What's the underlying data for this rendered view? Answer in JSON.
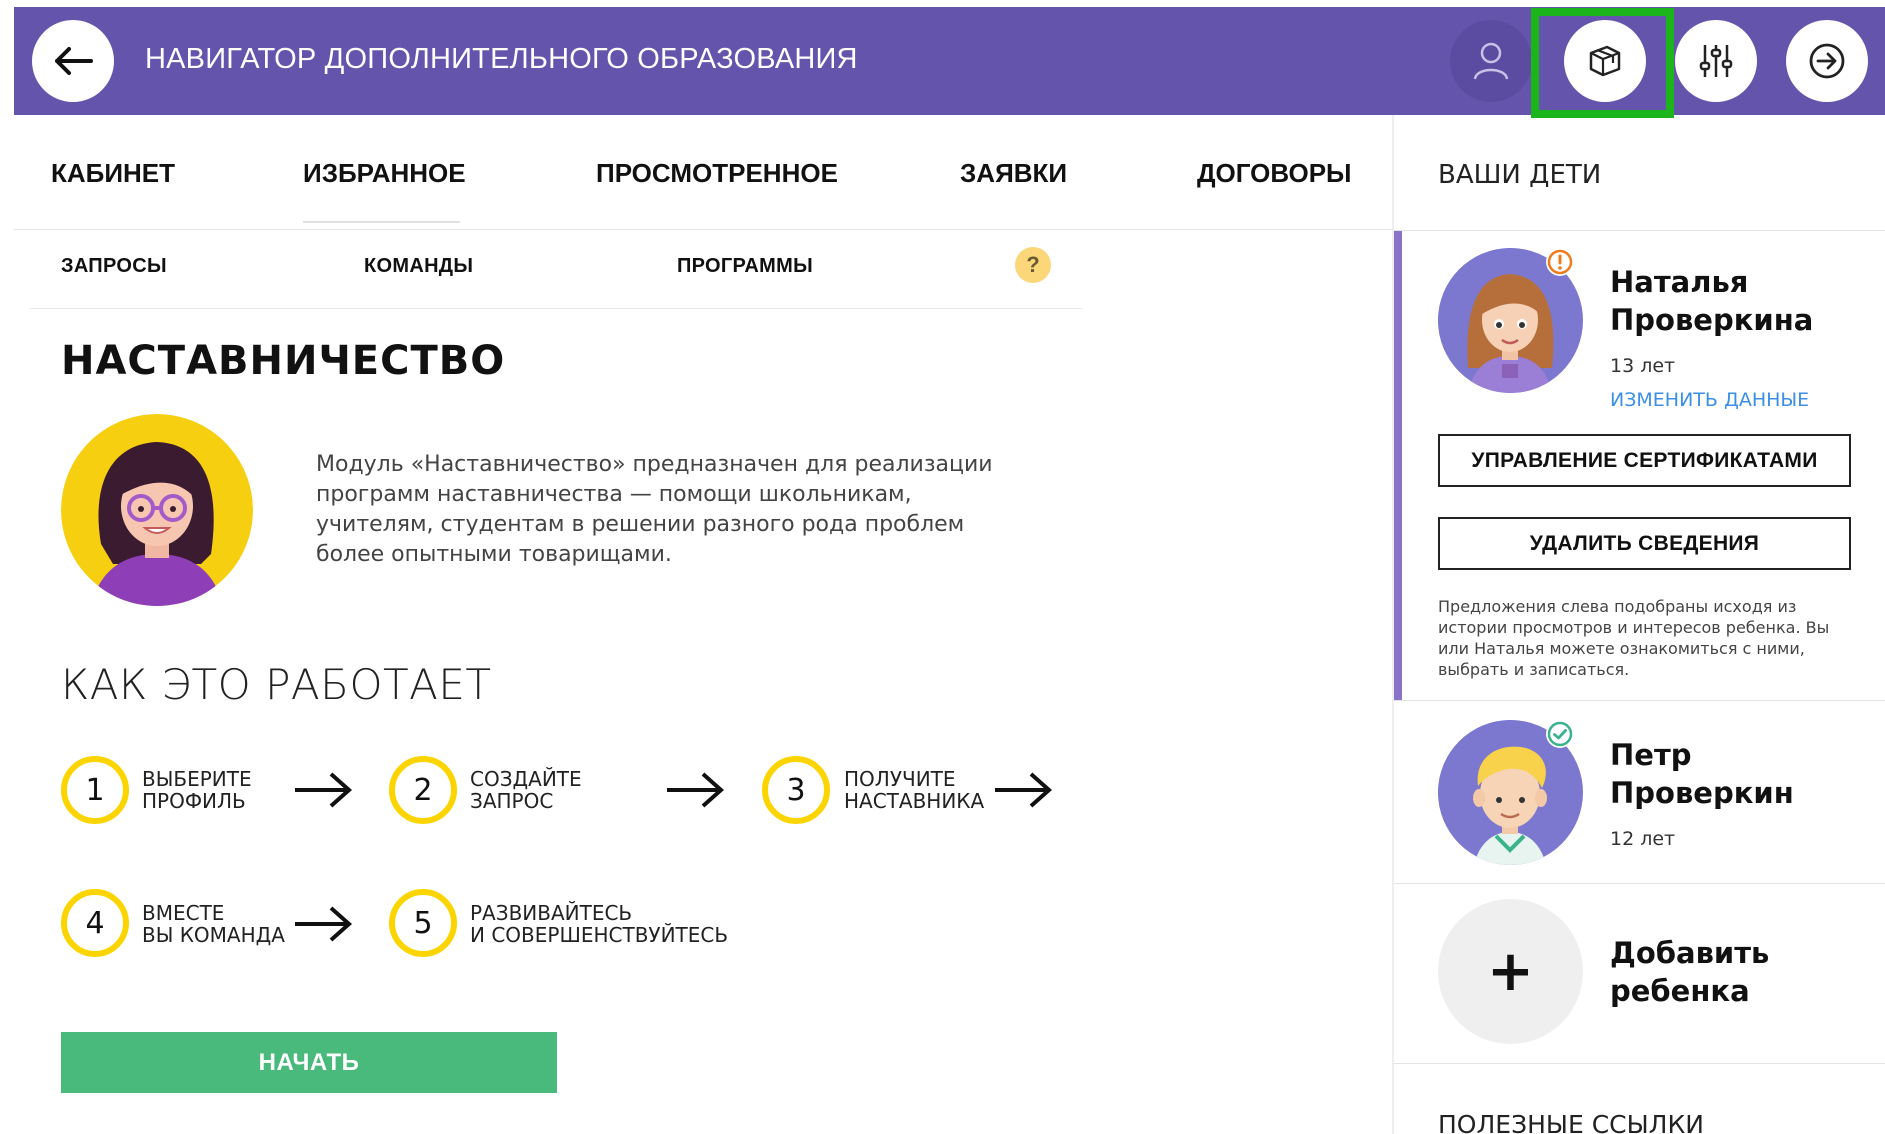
{
  "header": {
    "title": "НАВИГАТОР ДОПОЛНИТЕЛЬНОГО ОБРАЗОВАНИЯ",
    "icons": [
      "arrow-left-icon",
      "user-icon",
      "box-icon",
      "sliders-icon",
      "logout-icon"
    ],
    "color": "#6454ac",
    "highlight_color": "#1bb51b"
  },
  "tabs": [
    {
      "label": "КАБИНЕТ"
    },
    {
      "label": "ИЗБРАННОЕ"
    },
    {
      "label": "ПРОСМОТРЕННОЕ"
    },
    {
      "label": "ЗАЯВКИ"
    },
    {
      "label": "ДОГОВОРЫ"
    }
  ],
  "subtabs": [
    {
      "label": "ЗАПРОСЫ"
    },
    {
      "label": "КОМАНДЫ"
    },
    {
      "label": "ПРОГРАММЫ"
    }
  ],
  "help_label": "?",
  "main": {
    "title": "НАСТАВНИЧЕСТВО",
    "description": "Модуль «Наставничество» предназначен для реализации программ наставничества — помощи школьникам, учителям, студентам в решении разного рода проблем более опытными товарищами.",
    "how_title": "КАК ЭТО РАБОТАЕТ",
    "steps": [
      {
        "num": "1",
        "text": "ВЫБЕРИТЕ\nПРОФИЛЬ"
      },
      {
        "num": "2",
        "text": "СОЗДАЙТЕ\nЗАПРОС"
      },
      {
        "num": "3",
        "text": "ПОЛУЧИТЕ\nНАСТАВНИКА"
      },
      {
        "num": "4",
        "text": "ВМЕСТЕ\nВЫ КОМАНДА"
      },
      {
        "num": "5",
        "text": "РАЗВИВАЙТЕСЬ\nИ СОВЕРШЕНСТВУЙТЕСЬ"
      }
    ],
    "start_label": "НАЧАТЬ",
    "accent_color": "#fcd400",
    "start_color": "#49ba7b"
  },
  "sidebar": {
    "title": "ВАШИ ДЕТИ",
    "children": [
      {
        "name": "Наталья\nПроверкина",
        "age": "13 лет",
        "edit_label": "ИЗМЕНИТЬ ДАННЫЕ",
        "status": "warning",
        "certificates_label": "УПРАВЛЕНИЕ СЕРТИФИКАТАМИ",
        "delete_label": "УДАЛИТЬ СВЕДЕНИЯ",
        "note": "Предложения слева подобраны исходя из истории просмотров и интересов ребенка. Вы или Наталья можете ознакомиться с ними, выбрать и записаться."
      },
      {
        "name": "Петр\nПроверкин",
        "age": "12 лет",
        "status": "ok"
      }
    ],
    "add_child_label": "Добавить\nребенка",
    "add_icon": "+",
    "useful_links": "ПОЛЕЗНЫЕ ССЫЛКИ"
  }
}
